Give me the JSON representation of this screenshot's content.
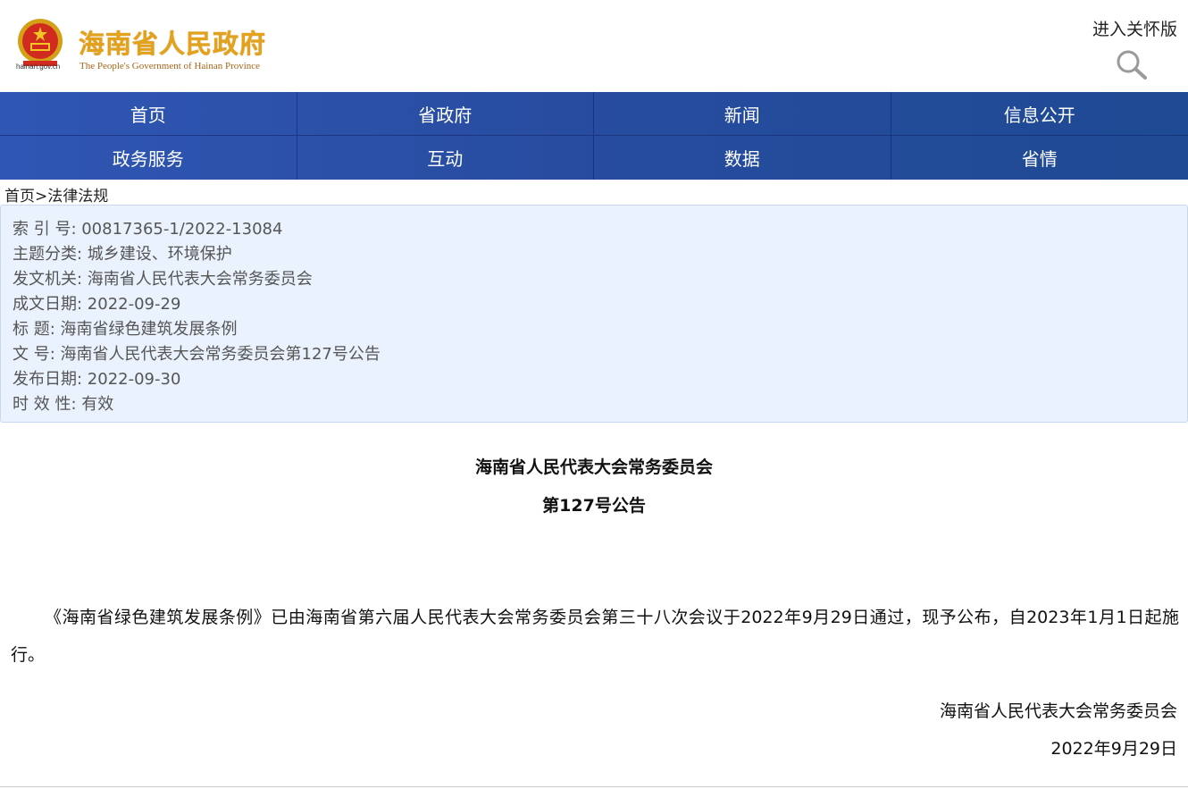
{
  "header": {
    "site_title": "海南省人民政府",
    "site_subtitle": "The People's Government of Hainan Province",
    "domain": "hainan.gov.cn",
    "care_mode": "进入关怀版"
  },
  "nav": {
    "items": [
      "首页",
      "省政府",
      "新闻",
      "信息公开",
      "政务服务",
      "互动",
      "数据",
      "省情"
    ]
  },
  "breadcrumb": {
    "home": "首页",
    "separator": ">",
    "current": "法律法规"
  },
  "info": {
    "index_no": "索  引  号:  00817365-1/2022-13084",
    "category": "主题分类:  城乡建设、环境保护",
    "issuer": "发文机关:  海南省人民代表大会常务委员会",
    "written_date": "成文日期:  2022-09-29",
    "title": "标    题:   海南省绿色建筑发展条例",
    "doc_no": "文    号:  海南省人民代表大会常务委员会第127号公告",
    "publish_date": "发布日期:   2022-09-30",
    "validity": "时  效  性:  有效"
  },
  "article": {
    "heading": "海南省人民代表大会常务委员会",
    "subheading": "第127号公告",
    "body": "《海南省绿色建筑发展条例》已由海南省第六届人民代表大会常务委员会第三十八次会议于2022年9月29日通过，现予公布，自2023年1月1日起施行。",
    "signature": "海南省人民代表大会常务委员会",
    "date": "2022年9月29日"
  },
  "colors": {
    "nav_bg": "#274c9f",
    "title_gold": "#e3a21c",
    "info_bg": "#eaf2fe"
  }
}
